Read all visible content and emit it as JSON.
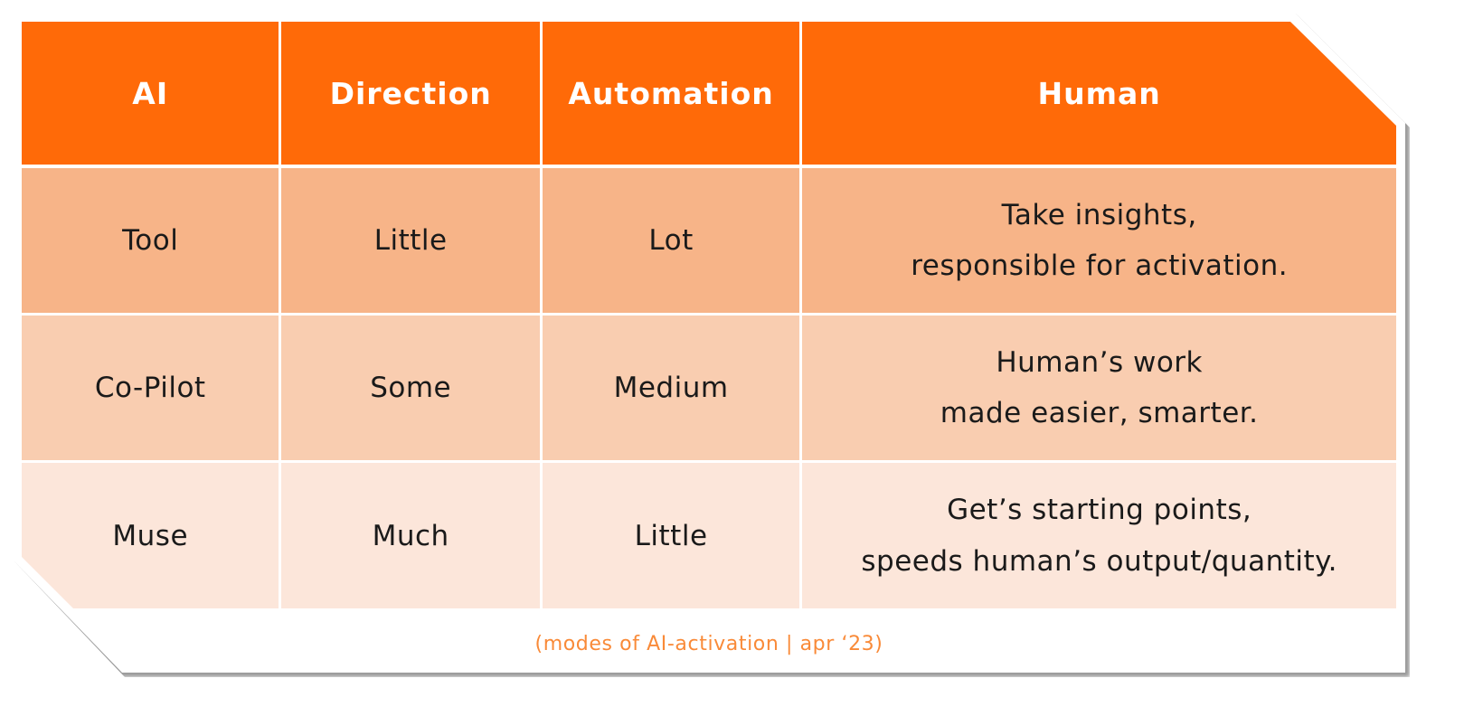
{
  "table": {
    "headers": [
      "AI",
      "Direction",
      "Automation",
      "Human"
    ],
    "rows": [
      {
        "ai": "Tool",
        "direction": "Little",
        "automation": "Lot",
        "human": [
          "Take insights,",
          "responsible for activation."
        ]
      },
      {
        "ai": "Co-Pilot",
        "direction": "Some",
        "automation": "Medium",
        "human": [
          "Human’s work",
          "made easier, smarter."
        ]
      },
      {
        "ai": "Muse",
        "direction": "Much",
        "automation": "Little",
        "human": [
          "Get’s starting points,",
          "speeds human’s output/quantity."
        ]
      }
    ]
  },
  "caption": "(modes of AI-activation | apr ‘23)",
  "colors": {
    "header": "#FF6A08",
    "row_1": "#F7B488",
    "row_2": "#F9CDB0",
    "row_3": "#FCE6DA",
    "caption": "#F98A38",
    "header_text": "#FFFFFF",
    "body_text": "#1A1A1A"
  }
}
